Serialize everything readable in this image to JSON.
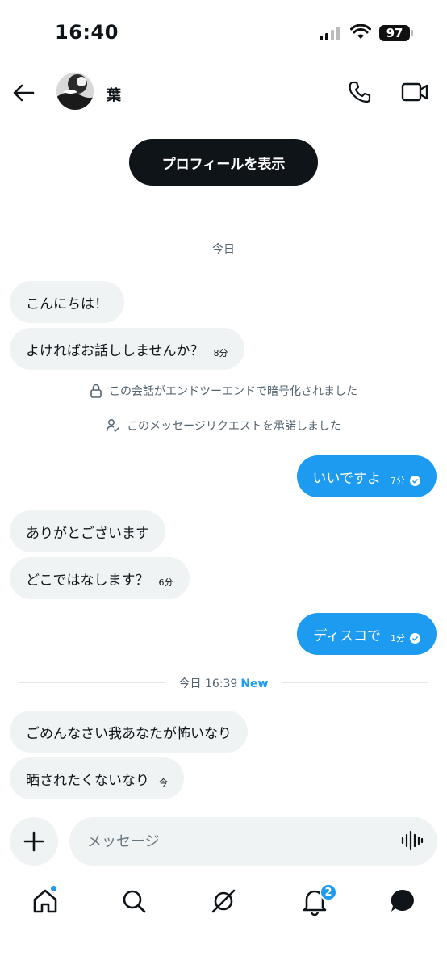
{
  "status_bar": {
    "time": "16:40",
    "battery": "97"
  },
  "header": {
    "contact_name": "葉"
  },
  "profile_button": "プロフィールを表示",
  "date_today": "今日",
  "messages": [
    {
      "text": "こんにちは！",
      "meta": ""
    },
    {
      "text": "よければお話ししませんか？",
      "meta": "8分"
    },
    {
      "text": "いいですよ",
      "meta": "7分"
    },
    {
      "text": "ありがとございます",
      "meta": ""
    },
    {
      "text": "どこではなします？",
      "meta": "6分"
    },
    {
      "text": "ディスコで",
      "meta": "1分"
    },
    {
      "text": "ごめんなさい我あなたが怖いなり",
      "meta": ""
    },
    {
      "text": "晒されたくないなり",
      "meta": "今"
    }
  ],
  "system": {
    "encrypted": "この会話がエンドツーエンドで暗号化されました",
    "request_accepted": "このメッセージリクエストを承諾しました"
  },
  "divider": {
    "label": "今日 16:39",
    "new_label": "New"
  },
  "composer": {
    "placeholder": "メッセージ"
  },
  "tabbar": {
    "notifications_count": "2"
  },
  "colors": {
    "accent": "#1d9bf0",
    "bubble_in": "#eff3f4",
    "dark": "#0f1419"
  }
}
